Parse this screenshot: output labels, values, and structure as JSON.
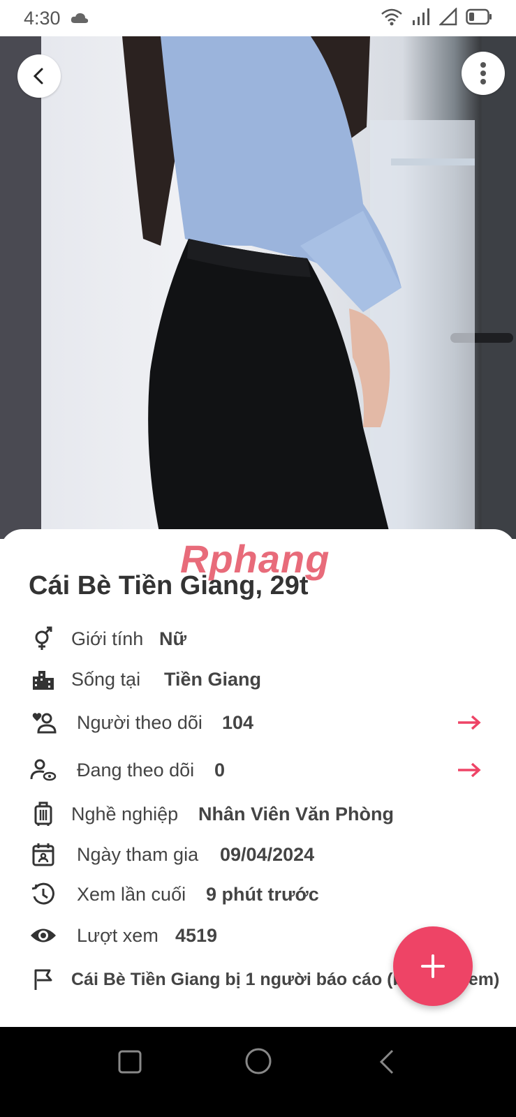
{
  "status_bar": {
    "time": "4:30"
  },
  "profile": {
    "title": "Cái Bè Tiền Giang, 29t",
    "watermark": "Rphang",
    "rows": [
      {
        "label": "Giới tính",
        "value": "Nữ"
      },
      {
        "label": "Sống tại",
        "value": "Tiền Giang"
      },
      {
        "label": "Người theo dõi",
        "value": "104"
      },
      {
        "label": "Đang theo dõi",
        "value": "0"
      },
      {
        "label": "Nghề nghiệp",
        "value": "Nhân Viên Văn Phòng"
      },
      {
        "label": "Ngày tham gia",
        "value": "09/04/2024"
      },
      {
        "label": "Xem lần cuối",
        "value": "9 phút trước"
      },
      {
        "label": "Lượt xem",
        "value": "4519"
      }
    ],
    "report_text": "Cái Bè Tiền Giang bị 1 người báo cáo (bấm để xem)"
  },
  "colors": {
    "accent": "#ee4466",
    "text": "#444444"
  },
  "icons": [
    "back-arrow-icon",
    "more-vertical-icon",
    "gender-icon",
    "city-icon",
    "followers-icon",
    "following-icon",
    "briefcase-icon",
    "calendar-icon",
    "clock-history-icon",
    "eye-icon",
    "flag-icon",
    "arrow-right-icon",
    "plus-icon",
    "square-icon",
    "circle-icon",
    "triangle-back-icon"
  ]
}
